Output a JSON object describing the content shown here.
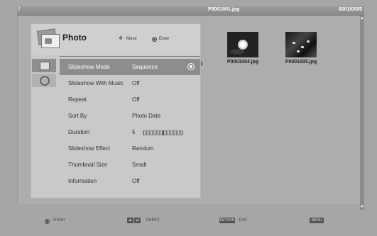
{
  "topbar": {
    "slash": "/",
    "filename": "P0001001.jpg",
    "counter": "0001/0005"
  },
  "popup": {
    "title": "Photo",
    "hint_move": "Move",
    "hint_enter": "Enter",
    "items": [
      {
        "label": "Slideshow Mode",
        "value": "Sequence"
      },
      {
        "label": "Slideshow With Music",
        "value": "Off"
      },
      {
        "label": "Repeat",
        "value": "Off"
      },
      {
        "label": "Sort By",
        "value": "Photo Date"
      },
      {
        "label": "Duration",
        "value": "5"
      },
      {
        "label": "Slideshow Effect",
        "value": "Random"
      },
      {
        "label": "Thumbnail Size",
        "value": "Small"
      },
      {
        "label": "Information",
        "value": "Off"
      }
    ],
    "duration_level": 0.5
  },
  "thumbnails": [
    {
      "label": "P0001004.jpg"
    },
    {
      "label": "P0001005.jpg"
    }
  ],
  "partial_text": "g",
  "bottombar": {
    "enter": "Enter",
    "select_key_lr": "◂▸",
    "select_key_ud": "▴▾",
    "select": "Select",
    "return_key": "RETURN",
    "exit": "Exit",
    "menu_key": "MENU"
  }
}
